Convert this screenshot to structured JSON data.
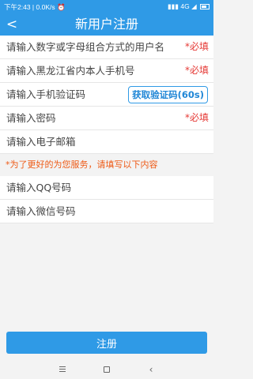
{
  "status_bar": {
    "time": "下午2:43",
    "network_speed": "0.0K/s",
    "alarm_icon": "alarm-clock-icon",
    "signal_text": "4G",
    "battery_icon": "battery-icon"
  },
  "nav": {
    "back_glyph": "<",
    "title": "新用户注册"
  },
  "form": {
    "username_placeholder": "请输入数字或字母组合方式的用户名",
    "username_required": "*必填",
    "phone_placeholder": "请输入黑龙江省内本人手机号",
    "phone_required": "*必填",
    "code_placeholder": "请输入手机验证码",
    "code_button": "获取验证码(60s)",
    "password_placeholder": "请输入密码",
    "password_required": "*必填",
    "email_placeholder": "请输入电子邮箱",
    "notice": "*为了更好的为您服务，请填写以下内容",
    "qq_placeholder": "请输入QQ号码",
    "wechat_placeholder": "请输入微信号码"
  },
  "submit_label": "注册",
  "system_nav": {
    "menu_icon": "menu-lines-icon",
    "home_icon": "home-square-icon",
    "back_icon": "back-chevron-icon",
    "back_glyph": "‹"
  },
  "colors": {
    "primary": "#2f9ae6",
    "required": "#e53935",
    "notice": "#ee5a16"
  }
}
